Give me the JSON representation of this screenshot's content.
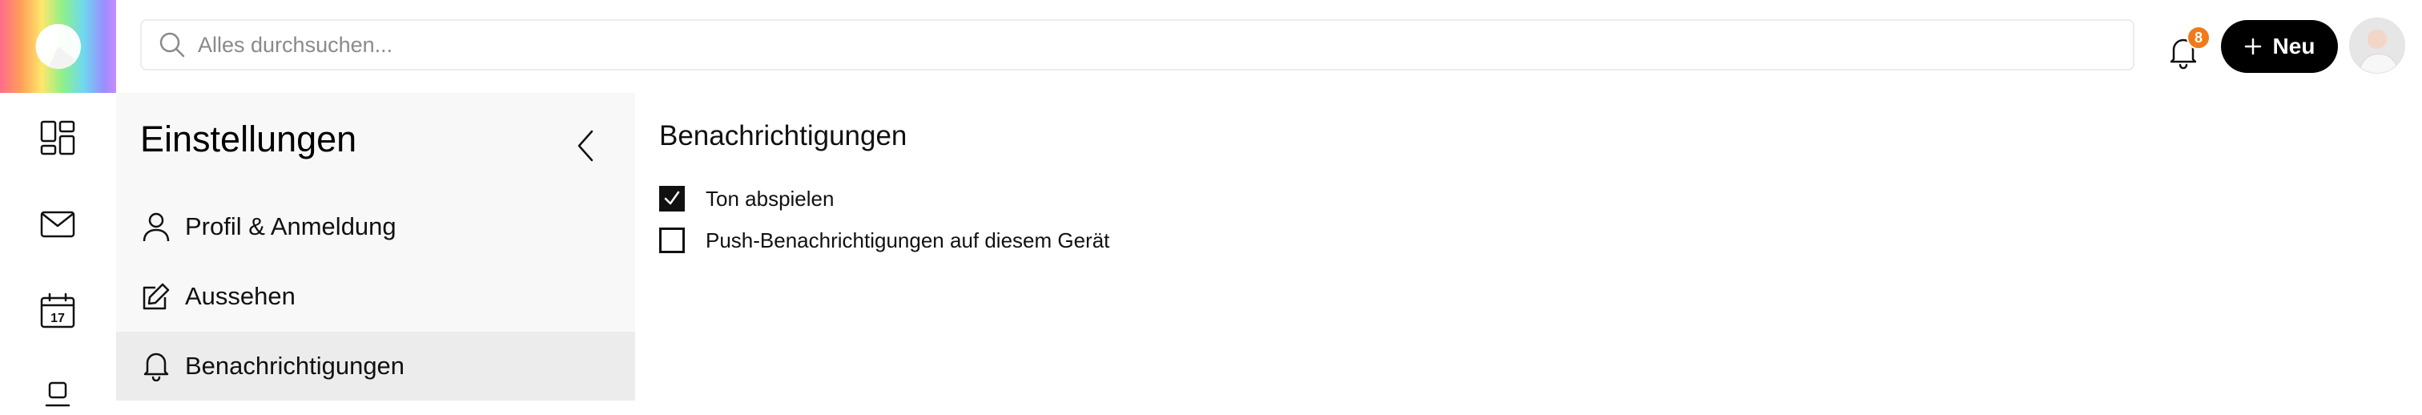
{
  "search": {
    "placeholder": "Alles durchsuchen..."
  },
  "notifications": {
    "badge_count": "8"
  },
  "header": {
    "new_button_label": "Neu"
  },
  "settings": {
    "title": "Einstellungen",
    "items": [
      {
        "label": "Profil & Anmeldung",
        "icon": "user-icon"
      },
      {
        "label": "Aussehen",
        "icon": "edit-icon"
      },
      {
        "label": "Benachrichtigungen",
        "icon": "bell-icon",
        "active": true
      }
    ]
  },
  "content": {
    "title": "Benachrichtigungen",
    "options": [
      {
        "label": "Ton abspielen",
        "checked": true
      },
      {
        "label": "Push-Benachrichtigungen auf diesem Gerät",
        "checked": false
      }
    ]
  },
  "rail": {
    "calendar_day": "17"
  },
  "colors": {
    "badge": "#f07a1a",
    "primary_button": "#000000",
    "active_nav_bg": "#ececec",
    "panel_bg": "#f8f8f8"
  }
}
